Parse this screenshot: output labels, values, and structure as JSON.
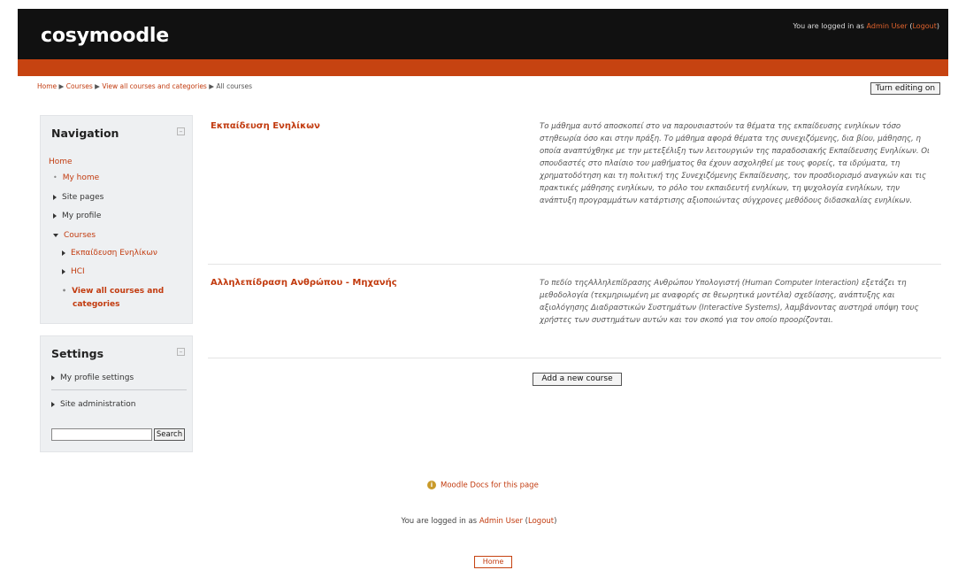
{
  "header": {
    "site_name": "cosymoodle",
    "login_prefix": "You are logged in as",
    "user_name": "Admin User",
    "logout_open": " (",
    "logout_label": "Logout",
    "logout_close": ")"
  },
  "breadcrumb": {
    "items": [
      "Home",
      "Courses",
      "View all courses and categories",
      "All courses"
    ],
    "separator": " ▶ "
  },
  "buttons": {
    "turn_editing_on": "Turn editing on",
    "add_new_course": "Add a new course",
    "search": "Search"
  },
  "navigation_block": {
    "title": "Navigation",
    "collapse_symbol": "–",
    "items": [
      {
        "label": "Home",
        "type": "link"
      },
      {
        "label": "My home",
        "type": "link"
      },
      {
        "label": "Site pages",
        "type": "collapsed"
      },
      {
        "label": "My profile",
        "type": "collapsed"
      },
      {
        "label": "Courses",
        "type": "expanded"
      },
      {
        "label": "Εκπαίδευση Ενηλίκων",
        "type": "collapsed-link"
      },
      {
        "label": "HCI",
        "type": "collapsed-link"
      },
      {
        "label": "View all courses and",
        "type": "current"
      },
      {
        "label": "categories",
        "type": "current"
      }
    ]
  },
  "settings_block": {
    "title": "Settings",
    "collapse_symbol": "–",
    "items": [
      {
        "label": "My profile settings"
      },
      {
        "label": "Site administration"
      }
    ],
    "search_value": ""
  },
  "courses": [
    {
      "name": "Εκπαίδευση Ενηλίκων",
      "summary": "Το μάθημα αυτό αποσκοπεί στο να παρουσιαστούν τα θέματα της εκπαίδευσης ενηλίκων τόσο στηθεωρία όσο και στην πράξη. Το μάθημα αφορά θέματα της συνεχιζόμενης, δια βίου, μάθησης, η οποία αναπτύχθηκε με την μετεξέλιξη των λειτουργιών της παραδοσιακής Εκπαίδευσης Ενηλίκων. Οι σπουδαστές στο πλαίσιο του μαθήματος θα έχουν ασχοληθεί με τους φορείς, τα ιδρύματα, τη χρηματοδότηση και τη πολιτική της Συνεχιζόμενης Εκπαίδευσης, τον προσδιορισμό αναγκών και τις πρακτικές μάθησης ενηλίκων, το ρόλο του εκπαιδευτή ενηλίκων, τη ψυχολογία ενηλίκων, την ανάπτυξη προγραμμάτων κατάρτισης αξιοποιώντας σύγχρονες μεθόδους διδασκαλίας ενηλίκων."
    },
    {
      "name": "Αλληλεπίδραση Ανθρώπου - Μηχανής",
      "summary": "Το πεδίο τηςΑλληλεπίδρασης Ανθρώπου Υπολογιστή (Human Computer Interaction) εξετάζει τη μεθοδολογία (τεκμηριωμένη με αναφορές σε θεωρητικά μοντέλα) σχεδίασης, ανάπτυξης και αξιολόγησης Διαδραστικών Συστημάτων (Interactive Systems), λαμβάνοντας αυστηρά υπόψη τους χρήστες των συστημάτων αυτών και τον σκοπό για τον οποίο προορίζονται."
    }
  ],
  "footer": {
    "docs_icon": "info-icon",
    "docs_link": "Moodle Docs for this page",
    "login_prefix": "You are logged in as",
    "user_name": "Admin User",
    "logout_open": " (",
    "logout_label": "Logout",
    "logout_close": ")",
    "home_button": "Home"
  },
  "colors": {
    "accent": "#c64311",
    "link": "#c23b0f",
    "header_bg": "#111111",
    "block_bg": "#eef0f2"
  }
}
